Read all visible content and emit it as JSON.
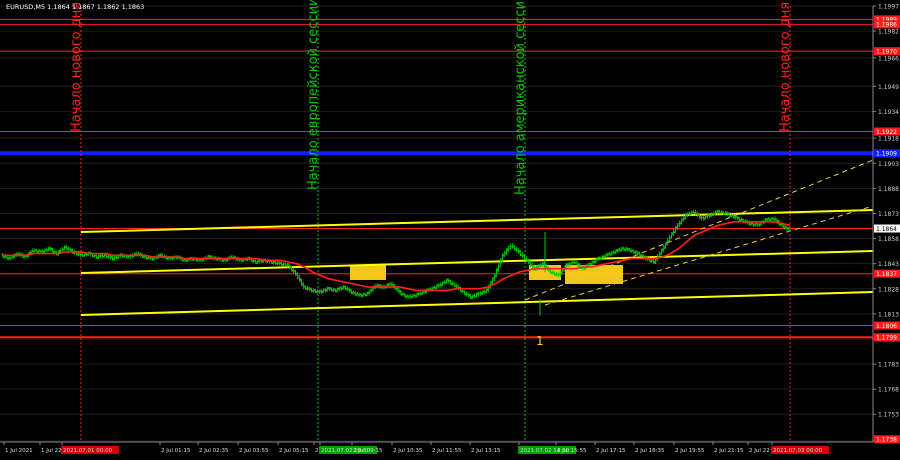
{
  "header": {
    "symbol_line": "EURUSD,M5  1.1864 1.1867 1.1862 1.1863"
  },
  "annotations": {
    "new_day_start": "Начало нового дня",
    "european_session": "Начало европейской сессии",
    "american_session": "Начало американской сессии",
    "marker_1": "1"
  },
  "colors": {
    "background": "#000000",
    "grid": "#2a2a2a",
    "candles": "#00c800",
    "moving_average": "#ff2020",
    "channel": "#ffff00",
    "level_lines": "#ff2020",
    "blue_level": "#1020ff",
    "session_lines": "#00c800",
    "highlight_box": "#ffd21e",
    "price_label_red": "#ff1a1a"
  },
  "chart_data": {
    "type": "line",
    "symbol": "EURUSD",
    "timeframe": "M5",
    "ylim": [
      1.1737,
      1.1997
    ],
    "y_ticks": [
      1.1997,
      1.1982,
      1.1966,
      1.1949,
      1.1934,
      1.1918,
      1.1903,
      1.1888,
      1.1873,
      1.1858,
      1.1843,
      1.1828,
      1.1813,
      1.1798,
      1.1783,
      1.1768,
      1.1753,
      1.1737
    ],
    "x_ticks": [
      "1 Jul 2021",
      "1 Jul 22:",
      "2021.07.01 00:00",
      "2 Jul 01:15",
      "2 Jul 02:35",
      "2 Jul 03:55",
      "2 Jul 05:15",
      "2 Jul 06:",
      "2021.07.02 08:00",
      "2 Jul 09:15",
      "2 Jul 10:35",
      "2 Jul 11:55",
      "2 Jul 13:15",
      "2021.07.02 14:00",
      "2 Jul 15:55",
      "2 Jul 17:15",
      "2 Jul 18:35",
      "2 Jul 19:55",
      "2 Jul 21:15",
      "2 Jul 22",
      "2021.07.03 00:00"
    ],
    "price_labels": [
      {
        "value": 1.1989,
        "label": "1.1989"
      },
      {
        "value": 1.1986,
        "label": "1.1986"
      },
      {
        "value": 1.197,
        "label": "1.1970"
      },
      {
        "value": 1.1922,
        "label": "1.1922"
      },
      {
        "value": 1.1909,
        "label": "1.1909"
      },
      {
        "value": 1.1864,
        "label": "1.1864"
      },
      {
        "value": 1.1837,
        "label": "1.1837"
      },
      {
        "value": 1.1806,
        "label": "1.1806"
      },
      {
        "value": 1.1799,
        "label": "1.1799"
      },
      {
        "value": 1.1738,
        "label": "1.1738"
      }
    ],
    "horizontal_levels": [
      1.1989,
      1.1986,
      1.197,
      1.1922,
      1.1864,
      1.1837,
      1.1806,
      1.1799
    ],
    "blue_level": 1.1909,
    "price_series": [
      1.1848,
      1.1846,
      1.1849,
      1.1847,
      1.1851,
      1.185,
      1.1852,
      1.1849,
      1.1853,
      1.185,
      1.1848,
      1.1849,
      1.1847,
      1.1848,
      1.1846,
      1.1848,
      1.1847,
      1.1849,
      1.1847,
      1.1846,
      1.1848,
      1.1846,
      1.1847,
      1.1845,
      1.1846,
      1.1845,
      1.1847,
      1.1846,
      1.1845,
      1.1847,
      1.1845,
      1.1846,
      1.1844,
      1.1845,
      1.1844,
      1.1843,
      1.1842,
      1.1837,
      1.1829,
      1.1827,
      1.1826,
      1.1828,
      1.1827,
      1.1829,
      1.1826,
      1.1824,
      1.1825,
      1.183,
      1.1829,
      1.1831,
      1.1826,
      1.1823,
      1.1824,
      1.1826,
      1.1828,
      1.183,
      1.1833,
      1.183,
      1.1826,
      1.1823,
      1.1825,
      1.1827,
      1.1836,
      1.1848,
      1.1854,
      1.185,
      1.1845,
      1.184,
      1.1843,
      1.1838,
      1.1836,
      1.1842,
      1.1844,
      1.184,
      1.1843,
      1.1846,
      1.1848,
      1.185,
      1.1852,
      1.1851,
      1.1849,
      1.1846,
      1.1844,
      1.1851,
      1.1859,
      1.1866,
      1.1872,
      1.1874,
      1.187,
      1.1872,
      1.1874,
      1.1873,
      1.1871,
      1.1869,
      1.1867,
      1.1866,
      1.1869,
      1.187,
      1.1866,
      1.1863
    ],
    "ma_series": [
      1.1848,
      1.1848,
      1.1848,
      1.1848,
      1.1849,
      1.1849,
      1.1849,
      1.1849,
      1.185,
      1.185,
      1.185,
      1.1849,
      1.1849,
      1.1849,
      1.1848,
      1.1848,
      1.1848,
      1.1848,
      1.1848,
      1.1847,
      1.1847,
      1.1847,
      1.1847,
      1.1846,
      1.1846,
      1.1846,
      1.1846,
      1.1846,
      1.1846,
      1.1846,
      1.1846,
      1.1846,
      1.1846,
      1.1845,
      1.1845,
      1.1845,
      1.1844,
      1.1843,
      1.1841,
      1.1838,
      1.1836,
      1.1834,
      1.1833,
      1.1832,
      1.1831,
      1.183,
      1.1829,
      1.1829,
      1.1829,
      1.1829,
      1.1829,
      1.1828,
      1.1827,
      1.1827,
      1.1827,
      1.1827,
      1.1827,
      1.1828,
      1.1828,
      1.1828,
      1.1828,
      1.1829,
      1.1831,
      1.1834,
      1.1836,
      1.1838,
      1.1839,
      1.184,
      1.184,
      1.184,
      1.184,
      1.184,
      1.184,
      1.1841,
      1.1841,
      1.1842,
      1.1843,
      1.1844,
      1.1845,
      1.1846,
      1.1846,
      1.1846,
      1.1846,
      1.1847,
      1.1849,
      1.1852,
      1.1856,
      1.186,
      1.1862,
      1.1864,
      1.1866,
      1.1867,
      1.1868,
      1.1868,
      1.1868,
      1.1868,
      1.1868,
      1.1868,
      1.1867,
      1.1866
    ]
  }
}
